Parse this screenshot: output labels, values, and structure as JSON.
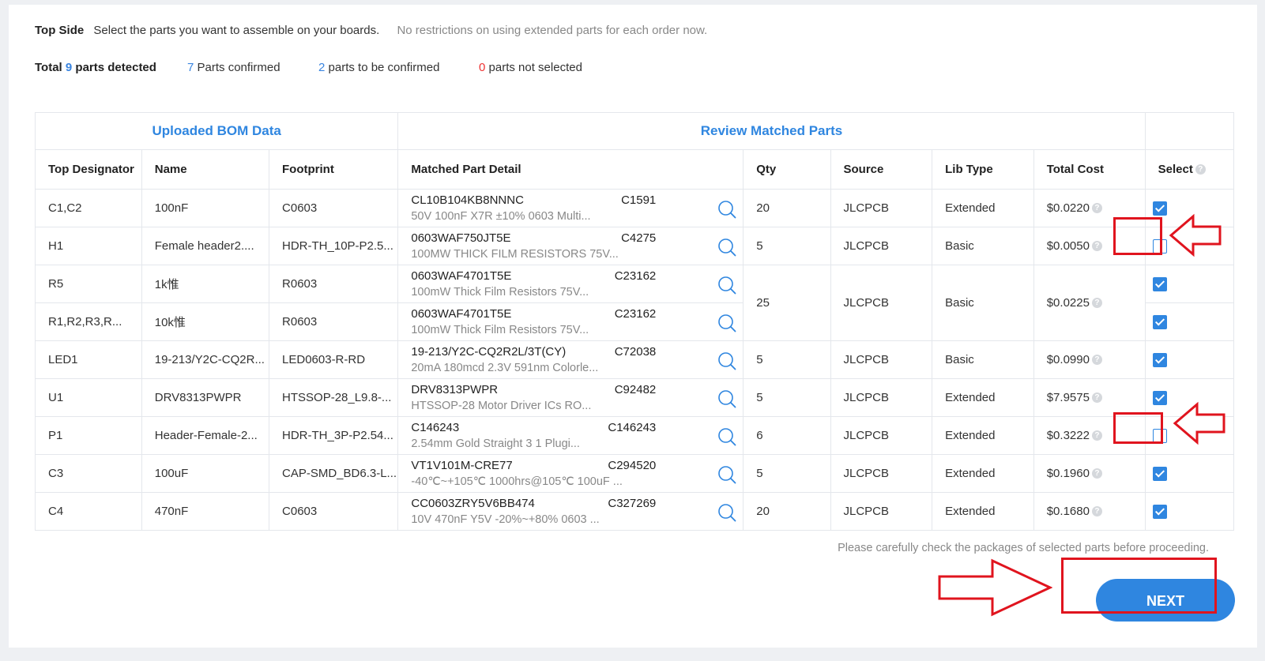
{
  "header": {
    "side_label": "Top Side",
    "instruction": "Select the parts you want to assemble on your boards.",
    "notice": "No restrictions on using extended parts for each order now."
  },
  "stats": {
    "total_prefix": "Total",
    "total_count": "9",
    "total_suffix": "parts detected",
    "confirmed_count": "7",
    "confirmed_label": "Parts confirmed",
    "to_confirm_count": "2",
    "to_confirm_label": "parts to be confirmed",
    "not_selected_count": "0",
    "not_selected_label": "parts not selected"
  },
  "table": {
    "group_left": "Uploaded BOM Data",
    "group_right": "Review Matched Parts",
    "columns": {
      "designator": "Top Designator",
      "name": "Name",
      "footprint": "Footprint",
      "detail": "Matched Part Detail",
      "qty": "Qty",
      "source": "Source",
      "lib_type": "Lib Type",
      "total_cost": "Total Cost",
      "select": "Select"
    },
    "rows": [
      {
        "designator": "C1,C2",
        "name": "100nF",
        "footprint": "C0603",
        "part": "CL10B104KB8NNNC",
        "code": "C1591",
        "desc": "50V 100nF X7R ±10% 0603 Multi...",
        "qty": "20",
        "source": "JLCPCB",
        "lib": "Extended",
        "cost": "$0.0220",
        "selected": true
      },
      {
        "designator": "H1",
        "name": "Female header2....",
        "footprint": "HDR-TH_10P-P2.5...",
        "part": "0603WAF750JT5E",
        "code": "C4275",
        "desc": "100MW THICK FILM RESISTORS 75V...",
        "qty": "5",
        "source": "JLCPCB",
        "lib": "Basic",
        "cost": "$0.0050",
        "selected": false
      },
      {
        "designator": "R5",
        "name": "1k惟",
        "footprint": "R0603",
        "part": "0603WAF4701T5E",
        "code": "C23162",
        "desc": "100mW Thick Film Resistors 75V...",
        "qty": "25",
        "source": "JLCPCB",
        "lib": "Basic",
        "cost": "$0.0225",
        "selected": true
      },
      {
        "designator": "R1,R2,R3,R...",
        "name": "10k惟",
        "footprint": "R0603",
        "part": "0603WAF4701T5E",
        "code": "C23162",
        "desc": "100mW Thick Film Resistors 75V...",
        "selected": true
      },
      {
        "designator": "LED1",
        "name": "19-213/Y2C-CQ2R...",
        "footprint": "LED0603-R-RD",
        "part": "19-213/Y2C-CQ2R2L/3T(CY)",
        "code": "C72038",
        "desc": "20mA 180mcd 2.3V 591nm Colorle...",
        "qty": "5",
        "source": "JLCPCB",
        "lib": "Basic",
        "cost": "$0.0990",
        "selected": true
      },
      {
        "designator": "U1",
        "name": "DRV8313PWPR",
        "footprint": "HTSSOP-28_L9.8-...",
        "part": "DRV8313PWPR",
        "code": "C92482",
        "desc": "HTSSOP-28 Motor Driver ICs RO...",
        "qty": "5",
        "source": "JLCPCB",
        "lib": "Extended",
        "cost": "$7.9575",
        "selected": true
      },
      {
        "designator": "P1",
        "name": "Header-Female-2...",
        "footprint": "HDR-TH_3P-P2.54...",
        "part": "C146243",
        "code": "C146243",
        "desc": "2.54mm Gold Straight 3 1 Plugi...",
        "qty": "6",
        "source": "JLCPCB",
        "lib": "Extended",
        "cost": "$0.3222",
        "selected": false
      },
      {
        "designator": "C3",
        "name": "100uF",
        "footprint": "CAP-SMD_BD6.3-L...",
        "part": "VT1V101M-CRE77",
        "code": "C294520",
        "desc": "-40℃~+105℃ 1000hrs@105℃ 100uF ...",
        "qty": "5",
        "source": "JLCPCB",
        "lib": "Extended",
        "cost": "$0.1960",
        "selected": true
      },
      {
        "designator": "C4",
        "name": "470nF",
        "footprint": "C0603",
        "part": "CC0603ZRY5V6BB474",
        "code": "C327269",
        "desc": "10V 470nF Y5V -20%~+80% 0603 ...",
        "qty": "20",
        "source": "JLCPCB",
        "lib": "Extended",
        "cost": "$0.1680",
        "selected": true
      }
    ]
  },
  "footer": {
    "note": "Please carefully check the packages of selected parts before proceeding.",
    "next_label": "NEXT"
  },
  "colors": {
    "accent": "#2f86e0",
    "annotation": "#e0141e",
    "danger": "#e33"
  },
  "icons": {
    "search": "magnifier-icon",
    "help": "question-icon",
    "arrow": "hollow-arrow-icon"
  }
}
